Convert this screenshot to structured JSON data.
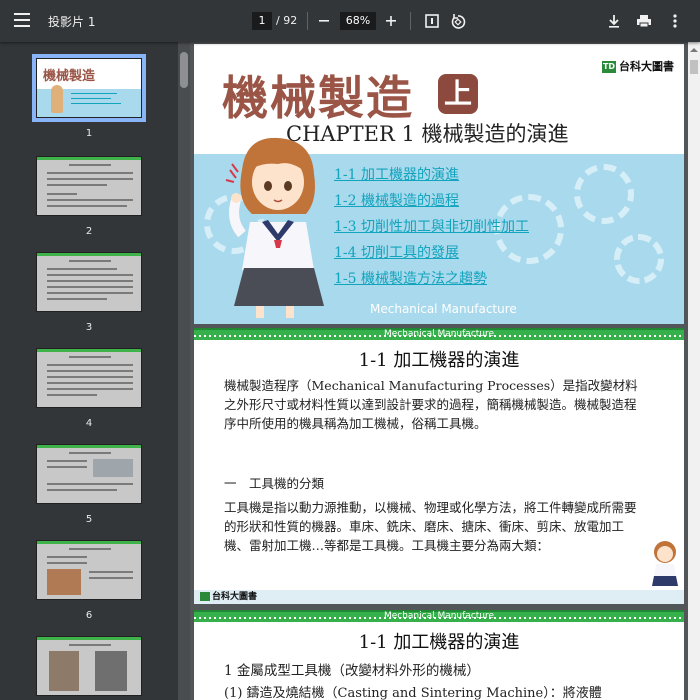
{
  "toolbar": {
    "title": "投影片 1",
    "page_current": "1",
    "page_total": "/ 92",
    "zoom": "68%"
  },
  "thumbnails": [
    {
      "num": "1"
    },
    {
      "num": "2"
    },
    {
      "num": "3"
    },
    {
      "num": "4"
    },
    {
      "num": "5"
    },
    {
      "num": "6"
    }
  ],
  "cover": {
    "title": "機械製造",
    "badge": "上",
    "chapter": "CHAPTER 1  機械製造的演進",
    "logo": "台科大圖書",
    "toc": [
      "1-1  加工機器的演進",
      "1-2  機械製造的過程",
      "1-3  切削性加工與非切削性加工",
      "1-4  切削工具的發展",
      "1-5  機械製造方法之趨勢"
    ],
    "footer": "Mechanical Manufacture"
  },
  "slide2": {
    "stripe": "Mechanical Manufacture",
    "title": "1-1  加工機器的演進",
    "para1": "機械製造程序（Mechanical Manufacturing Processes）是指改變材料之外形尺寸或材料性質以達到設計要求的過程，簡稱機械製造。機械製造程序中所使用的機具稱為加工機械，俗稱工具機。",
    "heading": "一　工具機的分類",
    "para2": "工具機是指以動力源推動，以機械、物理或化學方法，將工件轉變成所需要的形狀和性質的機器。車床、銑床、磨床、搪床、衝床、剪床、放電加工機、雷射加工機…等都是工具機。工具機主要分為兩大類：",
    "logo": "台科大圖書"
  },
  "slide3": {
    "stripe": "Mechanical Manufacture",
    "title": "1-1  加工機器的演進",
    "line1": "1 金屬成型工具機（改變材料外形的機械）",
    "line2": "(1) 鑄造及燒結機（Casting and Sintering Machine）：將液體"
  },
  "colors": {
    "toolbar": "#323639",
    "accent": "#8ab4f8",
    "cover_blue": "#a9d9ec",
    "title_brown": "#9a5547",
    "toc_cyan": "#12a4bd",
    "stripe_green": "#35b04a"
  }
}
